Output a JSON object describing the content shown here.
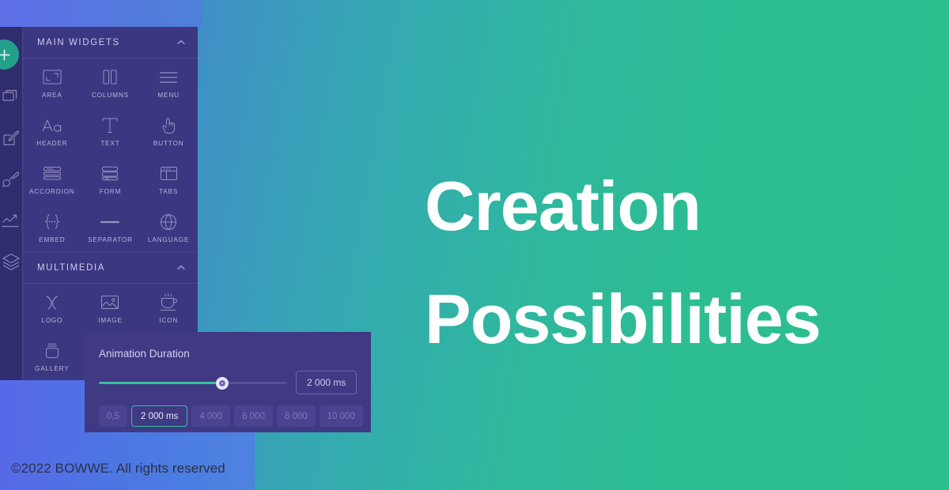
{
  "theme": {
    "bg_left": "#5b6fe6",
    "bg_right": "#2bbf8e",
    "panel_bg": "#3b3780",
    "rail_bg": "#302d6e",
    "accent_teal": "#38bfa0",
    "accent_plus": "#22a08c",
    "anim_panel_bg": "#3f3a83",
    "hero_text": "#ffffff",
    "footer_text": "#2b3243"
  },
  "rail": {
    "add_button_label": "+",
    "add_button_icon": "plus-icon",
    "items": [
      {
        "icon": "pages-icon",
        "name": "pages"
      },
      {
        "icon": "edit-pencil-icon",
        "name": "edit"
      },
      {
        "icon": "paint-brush-icon",
        "name": "design"
      },
      {
        "icon": "analytics-trend-icon",
        "name": "analytics"
      },
      {
        "icon": "layers-icon",
        "name": "layers"
      }
    ]
  },
  "panel": {
    "sections": [
      {
        "title": "MAIN WIDGETS",
        "collapse_icon": "chevron-up-icon",
        "widgets": [
          {
            "label": "AREA",
            "icon": "area-icon"
          },
          {
            "label": "COLUMNS",
            "icon": "columns-icon"
          },
          {
            "label": "MENU",
            "icon": "menu-lines-icon"
          },
          {
            "label": "HEADER",
            "icon": "header-aa-icon"
          },
          {
            "label": "TEXT",
            "icon": "text-t-icon"
          },
          {
            "label": "BUTTON",
            "icon": "button-pointer-icon"
          },
          {
            "label": "ACCORDION",
            "icon": "accordion-icon"
          },
          {
            "label": "FORM",
            "icon": "form-icon"
          },
          {
            "label": "TABS",
            "icon": "tabs-window-icon"
          },
          {
            "label": "EMBED",
            "icon": "embed-braces-icon"
          },
          {
            "label": "SEPARATOR",
            "icon": "separator-line-icon"
          },
          {
            "label": "LANGUAGE",
            "icon": "globe-icon"
          }
        ]
      },
      {
        "title": "MULTIMEDIA",
        "collapse_icon": "chevron-up-icon",
        "widgets": [
          {
            "label": "LOGO",
            "icon": "logo-icon"
          },
          {
            "label": "IMAGE",
            "icon": "image-picture-icon"
          },
          {
            "label": "ICON",
            "icon": "coffee-cup-icon"
          },
          {
            "label": "GALLERY",
            "icon": "gallery-jar-icon"
          }
        ]
      }
    ]
  },
  "animation": {
    "title": "Animation Duration",
    "value": "2 000 ms",
    "slider": {
      "percent": 63,
      "min_label": "0,5",
      "max_label": "10 000"
    },
    "presets": [
      {
        "label": "0,5",
        "active": false
      },
      {
        "label": "2 000 ms",
        "active": true
      },
      {
        "label": "4 000",
        "active": false
      },
      {
        "label": "6 000",
        "active": false
      },
      {
        "label": "8 000",
        "active": false
      },
      {
        "label": "10 000",
        "active": false
      }
    ]
  },
  "hero": {
    "line1": "Creation",
    "line2": "Possibilities"
  },
  "footer": {
    "copyright": "©2022 BOWWE. All rights reserved"
  }
}
